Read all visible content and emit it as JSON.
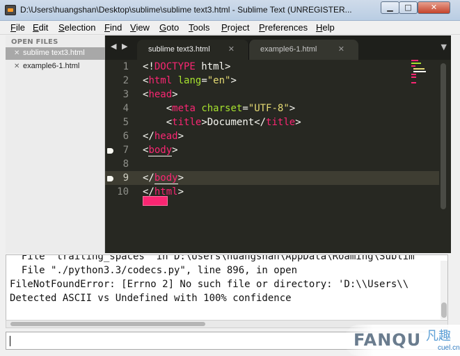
{
  "window": {
    "title": "D:\\Users\\huangshan\\Desktop\\sublime\\sublime text3.html - Sublime Text (UNREGISTER...",
    "min_glyph": "▁",
    "max_glyph": "□",
    "close_glyph": "✕"
  },
  "menu": [
    {
      "key": "F",
      "rest": "ile"
    },
    {
      "key": "E",
      "rest": "dit"
    },
    {
      "key": "S",
      "rest": "election"
    },
    {
      "key": "F",
      "rest": "ind"
    },
    {
      "key": "V",
      "rest": "iew"
    },
    {
      "key": "G",
      "rest": "oto"
    },
    {
      "key": "T",
      "rest": "ools"
    },
    {
      "key": "P",
      "rest": "roject"
    },
    {
      "key": "P",
      "rest": "references"
    },
    {
      "key": "H",
      "rest": "elp"
    }
  ],
  "sidebar": {
    "header": "OPEN FILES",
    "files": [
      {
        "name": "sublime text3.html",
        "active": true
      },
      {
        "name": "example6-1.html",
        "active": false
      }
    ]
  },
  "tabs": [
    {
      "label": "sublime text3.html",
      "active": true
    },
    {
      "label": "example6-1.html",
      "active": false
    }
  ],
  "editor": {
    "current_line": 9,
    "bookmarks": [
      7,
      9
    ],
    "lines": [
      {
        "no": "1",
        "parts": [
          [
            "tag-punct",
            "<!"
          ],
          [
            "tag",
            "DOCTYPE"
          ],
          [
            "txt",
            " html"
          ],
          [
            "tag-punct",
            ">"
          ]
        ]
      },
      {
        "no": "2",
        "parts": [
          [
            "tag-punct",
            "<"
          ],
          [
            "tag",
            "html"
          ],
          [
            "txt",
            " "
          ],
          [
            "attr",
            "lang"
          ],
          [
            "txt",
            "="
          ],
          [
            "str",
            "\"en\""
          ],
          [
            "tag-punct",
            ">"
          ]
        ]
      },
      {
        "no": "3",
        "parts": [
          [
            "tag-punct",
            "<"
          ],
          [
            "tag",
            "head"
          ],
          [
            "tag-punct",
            ">"
          ]
        ]
      },
      {
        "no": "4",
        "parts": [
          [
            "txt",
            "    "
          ],
          [
            "tag-punct",
            "<"
          ],
          [
            "tag",
            "meta"
          ],
          [
            "txt",
            " "
          ],
          [
            "attr",
            "charset"
          ],
          [
            "txt",
            "="
          ],
          [
            "str",
            "\"UTF-8\""
          ],
          [
            "tag-punct",
            ">"
          ]
        ]
      },
      {
        "no": "5",
        "parts": [
          [
            "txt",
            "    "
          ],
          [
            "tag-punct",
            "<"
          ],
          [
            "tag",
            "title"
          ],
          [
            "tag-punct",
            ">"
          ],
          [
            "txt",
            "Document"
          ],
          [
            "tag-punct",
            "</"
          ],
          [
            "tag",
            "title"
          ],
          [
            "tag-punct",
            ">"
          ]
        ]
      },
      {
        "no": "6",
        "parts": [
          [
            "tag-punct",
            "</"
          ],
          [
            "tag",
            "head"
          ],
          [
            "tag-punct",
            ">"
          ]
        ]
      },
      {
        "no": "7",
        "parts": [
          [
            "tag-punct",
            "<"
          ],
          [
            "tag-u",
            "body"
          ],
          [
            "tag-punct",
            ">"
          ]
        ]
      },
      {
        "no": "8",
        "parts": []
      },
      {
        "no": "9",
        "parts": [
          [
            "tag-punct",
            "</"
          ],
          [
            "tag-u",
            "body"
          ],
          [
            "tag-punct",
            ">"
          ]
        ]
      },
      {
        "no": "10",
        "parts": [
          [
            "tag-punct",
            "</"
          ],
          [
            "tag",
            "html"
          ],
          [
            "tag-punct",
            ">"
          ]
        ]
      }
    ]
  },
  "console": {
    "lines": [
      "  File \"trailing_spaces\" in D:\\Users\\huangshan\\AppData\\Roaming\\Sublim",
      "  File \"./python3.3/codecs.py\", line 896, in open",
      "FileNotFoundError: [Errno 2] No such file or directory: 'D:\\\\Users\\\\",
      "Detected ASCII vs Undefined with 100% confidence"
    ]
  },
  "watermark": {
    "text": "FANQU",
    "cn": "凡趣",
    "sub": "cuel.cn"
  },
  "colors": {
    "editor_bg": "#272822",
    "tag": "#f92672",
    "attr": "#a6e22e",
    "string": "#e6db74"
  }
}
